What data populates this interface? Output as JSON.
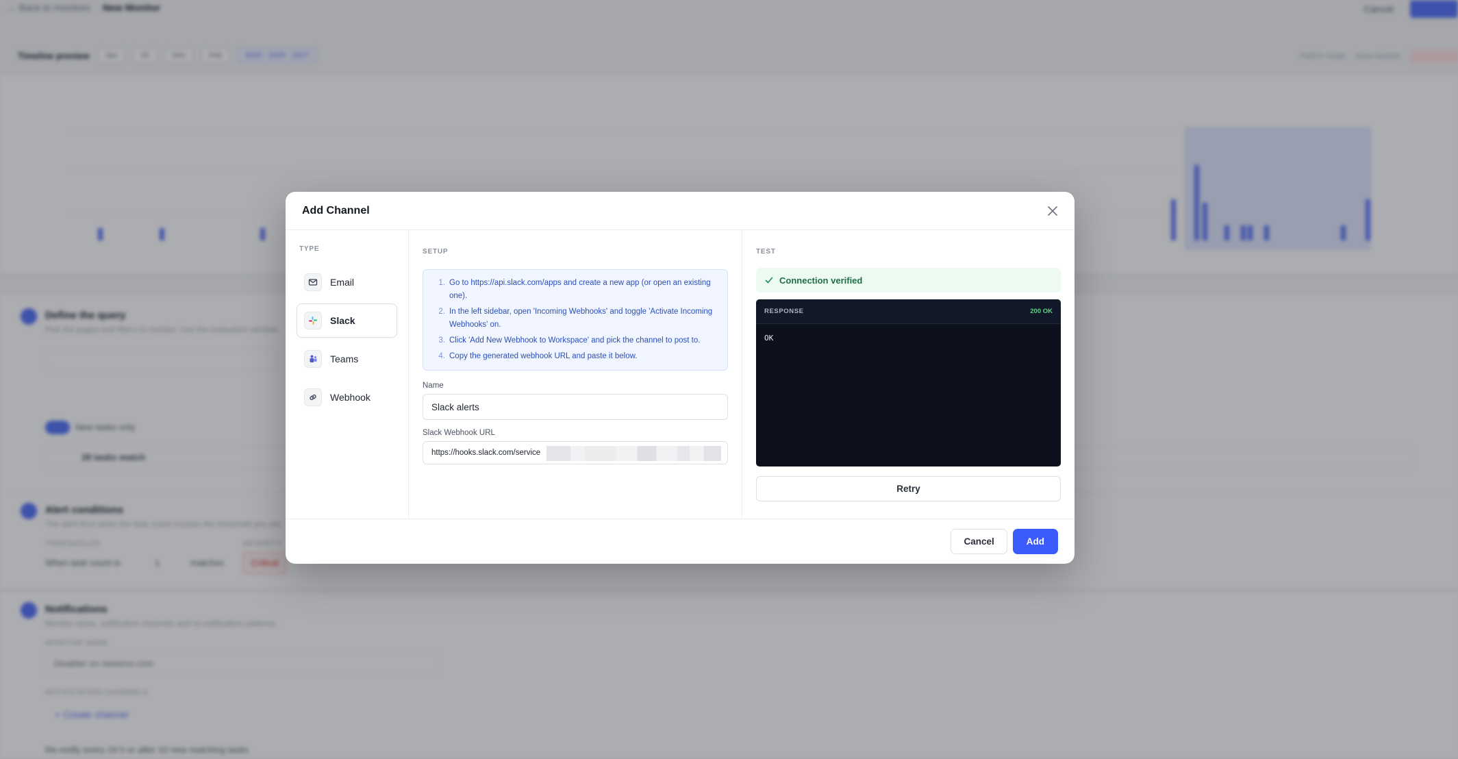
{
  "background": {
    "back_link": "← Back to monitors",
    "page_title": "New Monitor",
    "cancel": "Cancel",
    "chart_title": "Timeline preview",
    "chip_1": "Jan",
    "chip_2": "16",
    "chip_3": "Dec",
    "chip_4": "Feb",
    "chip_range": "2025 · 2025 · 2017",
    "legend_1": "Field in range",
    "legend_2": "Issue window",
    "step1_title": "Define the query",
    "step1_sub": "Pick the pages and filters to monitor. Use the evaluation window.",
    "step2_title": "Alert conditions",
    "step2_sub": "The alert fires when the task count crosses the threshold you set.",
    "thresholds_label": "THRESHOLDS",
    "severity_label": "SEVERITY",
    "threshold_text": "When task count is",
    "threshold_value": "1",
    "matches_text": "matches",
    "severity_value": "Critical",
    "step3_title": "Notifications",
    "step3_sub": "Monitor name, notification channels and re-notification cadence.",
    "monitor_name_label": "MONITOR NAME",
    "monitor_name_value": "Disabler on newsrss.com",
    "channels_label": "NOTIFICATION CHANNELS",
    "create_channel": "+ Create channel",
    "renotify_text": "Re-notify every   24   h   or after   10   new matching tasks",
    "tasks_match": "28 tasks match",
    "new_tasks_only": "New tasks only"
  },
  "modal": {
    "title": "Add Channel",
    "type_label": "TYPE",
    "setup_label": "SETUP",
    "test_label": "TEST",
    "types": [
      {
        "label": "Email"
      },
      {
        "label": "Slack"
      },
      {
        "label": "Teams"
      },
      {
        "label": "Webhook"
      }
    ],
    "instructions": [
      {
        "num": "1.",
        "text": "Go to https://api.slack.com/apps and create a new app (or open an existing one)."
      },
      {
        "num": "2.",
        "text": "In the left sidebar, open 'Incoming Webhooks' and toggle 'Activate Incoming Webhooks' on."
      },
      {
        "num": "3.",
        "text": "Click 'Add New Webhook to Workspace' and pick the channel to post to."
      },
      {
        "num": "4.",
        "text": "Copy the generated webhook URL and paste it below."
      }
    ],
    "name_label": "Name",
    "name_value": "Slack alerts",
    "url_label": "Slack Webhook URL",
    "url_value": "https://hooks.slack.com/service",
    "verified_text": "Connection verified",
    "response_label": "RESPONSE",
    "response_status": "200 OK",
    "response_body": "OK",
    "retry_label": "Retry",
    "cancel_label": "Cancel",
    "add_label": "Add"
  },
  "colors": {
    "accent": "#3b5bfd",
    "success": "#1f6f45",
    "instruction_text": "#2c4fb8"
  }
}
